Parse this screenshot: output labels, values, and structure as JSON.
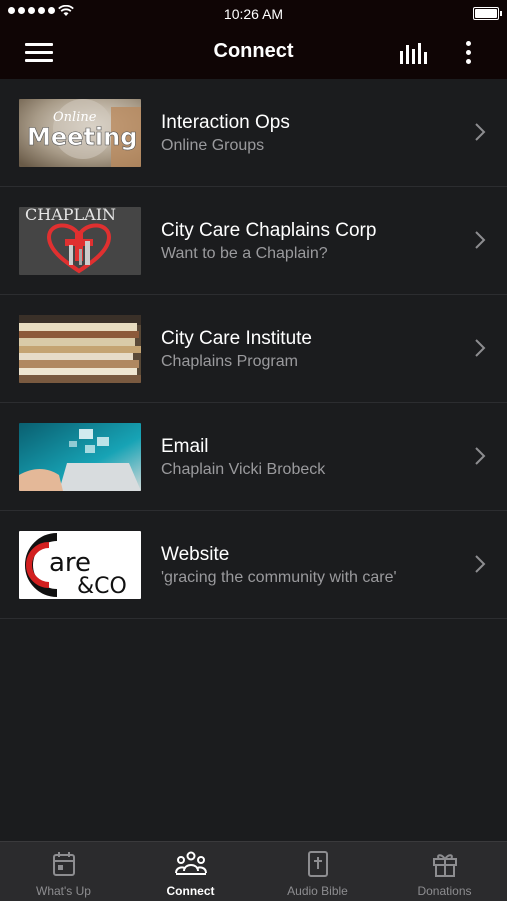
{
  "status_bar": {
    "time": "10:26 AM"
  },
  "header": {
    "title": "Connect"
  },
  "icons": {
    "menu": "menu-icon",
    "stats": "bar-chart-icon",
    "more": "more-vertical-icon",
    "chevron": "chevron-right-icon"
  },
  "items": [
    {
      "title": "Interaction Ops",
      "subtitle": "Online Groups",
      "thumb_text_1": "Online",
      "thumb_text_2": "Meeting"
    },
    {
      "title": "City Care Chaplains Corp",
      "subtitle": "Want to be a Chaplain?",
      "thumb_text_1": "CHAPLAIN"
    },
    {
      "title": "City Care Institute",
      "subtitle": "Chaplains Program"
    },
    {
      "title": "Email",
      "subtitle": "Chaplain Vicki Brobeck"
    },
    {
      "title": "Website",
      "subtitle": "'gracing the community with care'",
      "thumb_text_1": "are",
      "thumb_text_2": "&CO"
    }
  ],
  "tabs": [
    {
      "label": "What's Up",
      "icon": "calendar-icon",
      "active": false
    },
    {
      "label": "Connect",
      "icon": "people-icon",
      "active": true
    },
    {
      "label": "Audio Bible",
      "icon": "bible-icon",
      "active": false
    },
    {
      "label": "Donations",
      "icon": "gift-icon",
      "active": false
    }
  ],
  "colors": {
    "background": "#1b1c1e",
    "header": "#0f0505",
    "tab_bar": "#2b2b2d",
    "subtitle": "#9a9a9d"
  }
}
